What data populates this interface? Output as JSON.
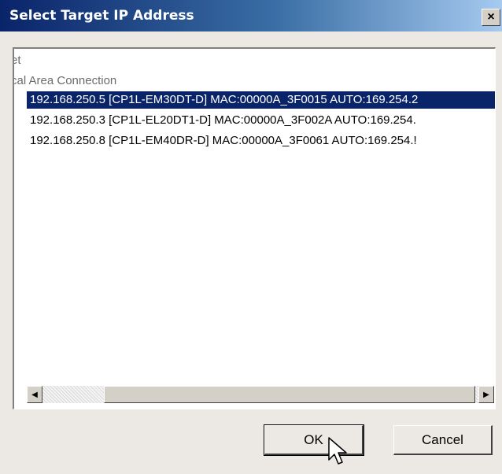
{
  "window": {
    "title": "Select Target IP Address",
    "close_glyph": "×"
  },
  "tree": {
    "partial_lines": [
      "et",
      "cal Area Connection"
    ],
    "items": [
      {
        "text": "192.168.250.5 [CP1L-EM30DT-D] MAC:00000A_3F0015 AUTO:169.254.2",
        "selected": true
      },
      {
        "text": "192.168.250.3 [CP1L-EL20DT1-D] MAC:00000A_3F002A AUTO:169.254.",
        "selected": false
      },
      {
        "text": "192.168.250.8 [CP1L-EM40DR-D] MAC:00000A_3F0061 AUTO:169.254.!",
        "selected": false
      }
    ]
  },
  "scrollbar": {
    "left_arrow": "◀",
    "right_arrow": "▶"
  },
  "buttons": {
    "ok_label": "OK",
    "cancel_label": "Cancel"
  },
  "colors": {
    "selection": "#0a246a",
    "title_gradient_start": "#0a246a",
    "title_gradient_end": "#a6caf0"
  },
  "icons": {
    "cursor": "mouse-pointer-icon"
  }
}
